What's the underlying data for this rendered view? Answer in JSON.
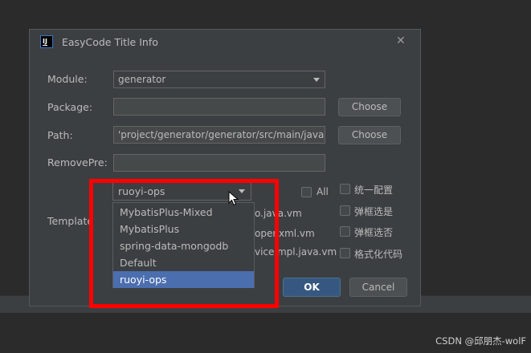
{
  "dialog": {
    "title": "EasyCode Title Info",
    "module": {
      "label": "Module:",
      "value": "generator"
    },
    "package": {
      "label": "Package:",
      "value": "",
      "button": "Choose"
    },
    "path": {
      "label": "Path:",
      "value": "'project/generator/generator/src/main/java",
      "button": "Choose"
    },
    "remove_pre": {
      "label": "RemovePre:",
      "value": ""
    },
    "template": {
      "label": "Template"
    },
    "group": {
      "value": "ruoyi-ops",
      "options": [
        "MybatisPlus-Mixed",
        "MybatisPlus",
        "spring-data-mongodb",
        "Default",
        "ruoyi-ops"
      ],
      "selected_index": 4
    },
    "all_label": "All",
    "options": {
      "unified_config": "统一配置",
      "popup_select": "弹框选是",
      "popup_select_no": "弹框选否",
      "format_code": "格式化代码"
    },
    "template_files": [
      "o.java.vm",
      "oper.xml.vm",
      "viceImpl.java.vm"
    ],
    "ok": "OK",
    "cancel": "Cancel"
  },
  "watermark": "CSDN @邱朋杰-wolF",
  "colors": {
    "highlight": "#ff0000",
    "selection": "#4b6eaf",
    "ok_button": "#365880"
  }
}
